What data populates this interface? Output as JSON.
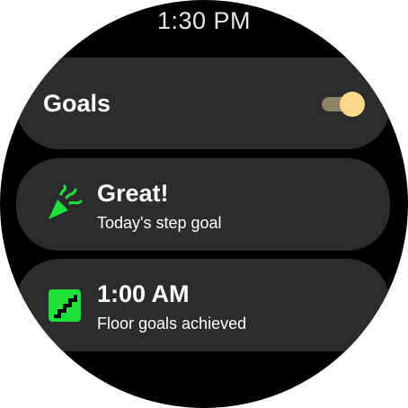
{
  "status": {
    "time": "1:30 PM"
  },
  "goals_card": {
    "title": "Goals",
    "toggle_on": true,
    "colors": {
      "track": "#8c8465",
      "thumb": "#fbd98b"
    }
  },
  "cards": [
    {
      "icon": "party-popper-icon",
      "title": "Great!",
      "subtitle": "Today's step goal",
      "icon_color": "#1ee23a"
    },
    {
      "icon": "stairs-icon",
      "title": "1:00 AM",
      "subtitle": "Floor goals achieved",
      "icon_color": "#1ee23a"
    }
  ],
  "colors": {
    "background": "#000000",
    "card": "#2c2c2e",
    "accent": "#1ee23a"
  }
}
